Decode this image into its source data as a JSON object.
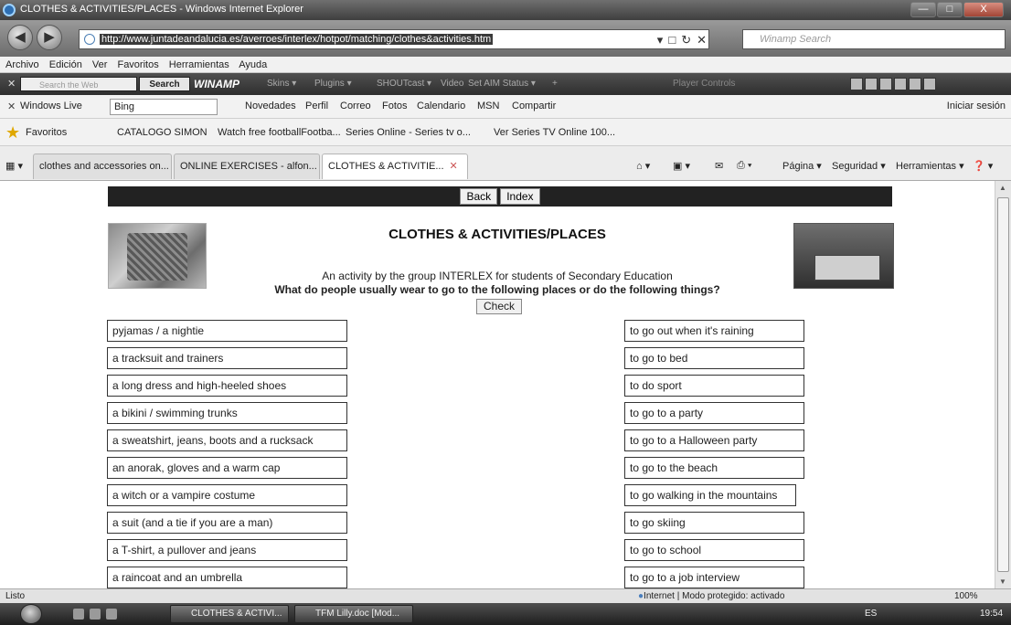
{
  "window": {
    "title": "CLOTHES & ACTIVITIES/PLACES - Windows Internet Explorer",
    "controls": [
      "—",
      "□",
      "X"
    ]
  },
  "address": {
    "url": "http://www.juntadeandalucia.es/averroes/interlex/hotpot/matching/clothes&activities.htm",
    "search_placeholder": "Winamp Search"
  },
  "menu": [
    "Archivo",
    "Edición",
    "Ver",
    "Favoritos",
    "Herramientas",
    "Ayuda"
  ],
  "winamp_bar": {
    "search_placeholder": "Search the Web",
    "search_label": "Search",
    "brand": "WINAMP",
    "items": [
      "Skins ▾",
      "Plugins ▾",
      "SHOUTcast ▾",
      "Video",
      "Set AIM Status ▾",
      "+"
    ],
    "player_label": "Player Controls"
  },
  "live_bar": {
    "label": "Windows Live",
    "search_value": "Bing",
    "items": [
      "Novedades",
      "Perfil",
      "Correo",
      "Fotos",
      "Calendario",
      "MSN",
      "Compartir"
    ],
    "signin": "Iniciar sesión"
  },
  "favorites_bar": {
    "label": "Favoritos",
    "items": [
      "CATALOGO SIMON",
      "Watch free footballFootba...",
      "Series Online - Series tv o...",
      "Ver Series TV Online 100..."
    ]
  },
  "tabs": [
    {
      "label": "clothes and accessories on..."
    },
    {
      "label": "ONLINE EXERCISES - alfon..."
    },
    {
      "label": "CLOTHES & ACTIVITIE..."
    }
  ],
  "commands": [
    "Página ▾",
    "Seguridad ▾",
    "Herramientas ▾"
  ],
  "page": {
    "nav_buttons": [
      "Back",
      "Index"
    ],
    "title": "CLOTHES & ACTIVITIES/PLACES",
    "subtitle": "An activity by the group INTERLEX for students of Secondary Education",
    "question": "What do people usually wear to go to the following places or do the following things?",
    "check_label": "Check",
    "clothes": [
      "pyjamas / a nightie",
      "a tracksuit and trainers",
      "a long dress and high-heeled shoes",
      "a bikini / swimming trunks",
      "a sweatshirt, jeans, boots and a rucksack",
      "an anorak, gloves and a warm cap",
      "a witch or a vampire costume",
      "a suit (and a tie if you are a man)",
      "a T-shirt, a pullover and jeans",
      "a raincoat and an umbrella"
    ],
    "activities": [
      "to go out when it's raining",
      "to go to bed",
      "to do sport",
      "to go to a party",
      "to go to a Halloween party",
      "to go to the beach",
      "to go walking in the mountains",
      "to go skiing",
      "to go to school",
      "to go to a job interview"
    ]
  },
  "status": {
    "left": "Listo",
    "zone": "Internet | Modo protegido: activado",
    "zoom": "100%"
  },
  "taskbar": {
    "items": [
      "CLOTHES & ACTIVI...",
      "TFM Lilly.doc [Mod..."
    ],
    "lang": "ES",
    "time": "19:54"
  }
}
